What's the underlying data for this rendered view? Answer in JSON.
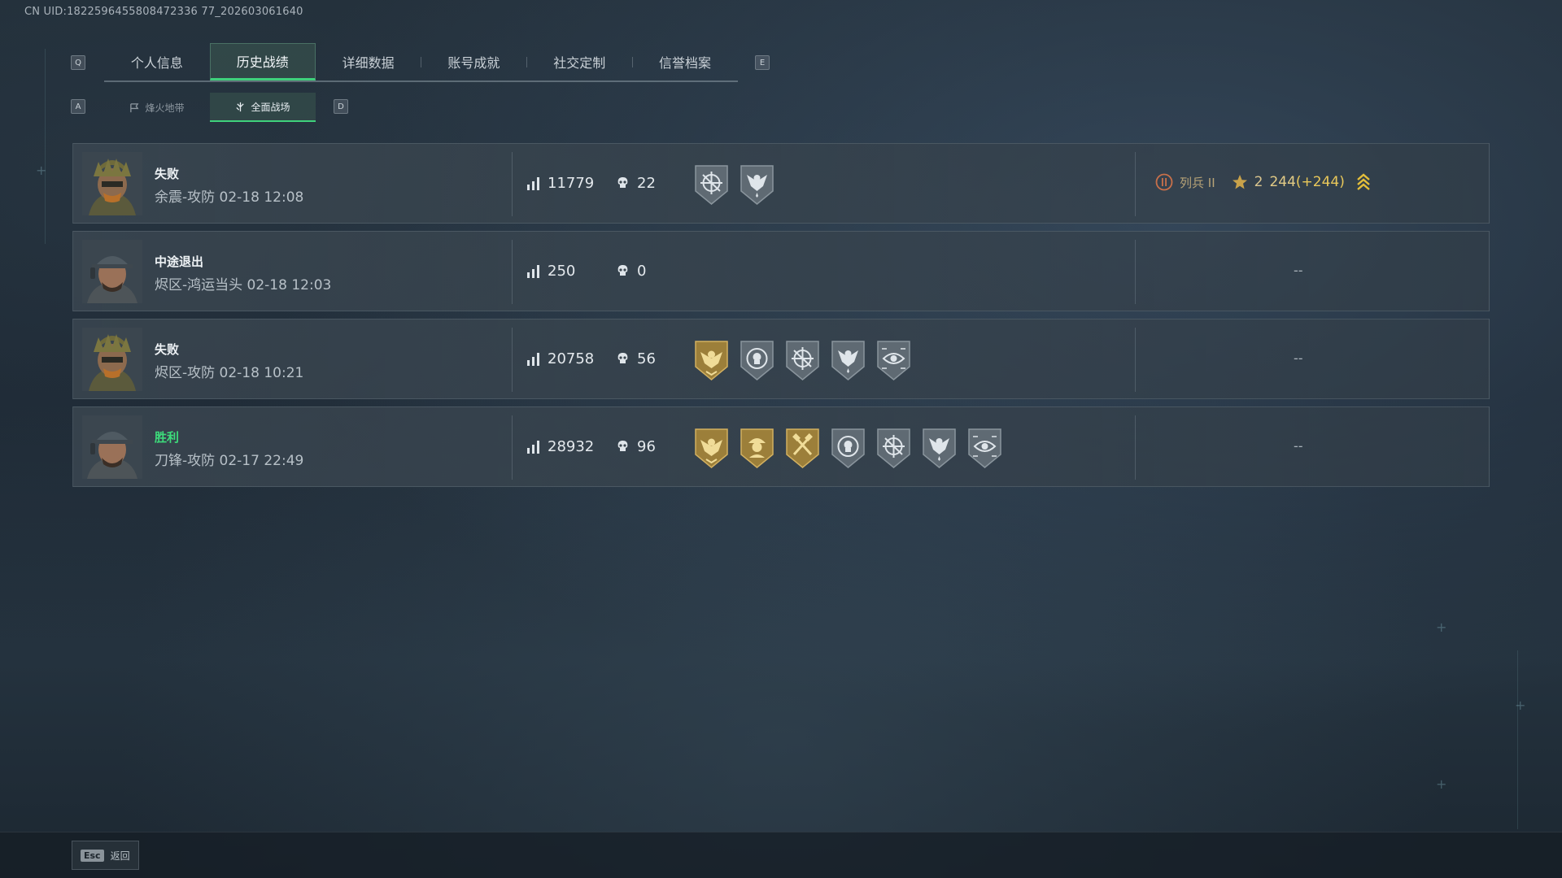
{
  "uid_text": "CN UID:1822596455808472336 77_202603061640",
  "tabs": {
    "left_key": "Q",
    "right_key": "E",
    "items": [
      {
        "label": "个人信息"
      },
      {
        "label": "历史战绩"
      },
      {
        "label": "详细数据"
      },
      {
        "label": "账号成就"
      },
      {
        "label": "社交定制"
      },
      {
        "label": "信誉档案"
      }
    ],
    "active_index": 1
  },
  "subtabs": {
    "left_key": "A",
    "right_key": "D",
    "items": [
      {
        "label": "烽火地带",
        "icon": "flag-icon"
      },
      {
        "label": "全面战场",
        "icon": "battlefield-icon"
      }
    ],
    "active_index": 1
  },
  "matches": [
    {
      "result": "失败",
      "is_win": false,
      "avatar": "helmet-soldier",
      "meta": "余震-攻防 02-18 12:08",
      "score": "11779",
      "kills": "22",
      "medals": [
        "crosshair-medal",
        "eagle-medal"
      ],
      "rank": {
        "name": "列兵 II",
        "stars": "2",
        "points": "244",
        "delta": "(+244)"
      },
      "dash": ""
    },
    {
      "result": "中途退出",
      "is_win": false,
      "avatar": "cap-soldier",
      "meta": "烬区-鸿运当头 02-18 12:03",
      "score": "250",
      "kills": "0",
      "medals": [],
      "rank": null,
      "dash": "--"
    },
    {
      "result": "失败",
      "is_win": false,
      "avatar": "helmet-soldier",
      "meta": "烬区-攻防 02-18 10:21",
      "score": "20758",
      "kills": "56",
      "medals": [
        "gold-eagle-medal",
        "target-medal",
        "crosshair-medal",
        "eagle-medal",
        "eye-medal"
      ],
      "rank": null,
      "dash": "--"
    },
    {
      "result": "胜利",
      "is_win": true,
      "avatar": "cap-soldier",
      "meta": "刀锋-攻防 02-17 22:49",
      "score": "28932",
      "kills": "96",
      "medals": [
        "gold-eagle-medal",
        "gold-soldier-medal",
        "gold-tools-medal",
        "target-medal",
        "crosshair-medal",
        "eagle-medal",
        "eye-medal"
      ],
      "rank": null,
      "dash": "--"
    }
  ],
  "footer": {
    "esc_key": "Esc",
    "back_label": "返回"
  },
  "colors": {
    "accent_green": "#3fd17c",
    "win_green": "#3ddc7b",
    "gold": "#c9a24a",
    "silver": "#6c7780"
  }
}
